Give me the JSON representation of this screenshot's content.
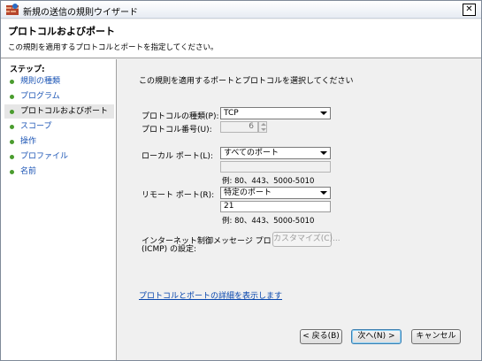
{
  "window": {
    "title": "新規の送信の規則ウイザード",
    "close_glyph": "✕"
  },
  "header": {
    "title": "プロトコルおよびポート",
    "description": "この規則を適用するプロトコルとポートを指定してください。"
  },
  "sidebar": {
    "steps_label": "ステップ:",
    "items": [
      {
        "label": "規則の種類",
        "current": false
      },
      {
        "label": "プログラム",
        "current": false
      },
      {
        "label": "プロトコルおよびポート",
        "current": true
      },
      {
        "label": "スコープ",
        "current": false
      },
      {
        "label": "操作",
        "current": false
      },
      {
        "label": "プロファイル",
        "current": false
      },
      {
        "label": "名前",
        "current": false
      }
    ]
  },
  "main": {
    "instruction": "この規則を適用するポートとプロトコルを選択してください",
    "protocol_type": {
      "label": "プロトコルの種類(P):",
      "value": "TCP"
    },
    "protocol_number": {
      "label": "プロトコル番号(U):",
      "value": "6"
    },
    "local_port": {
      "label": "ローカル ポート(L):",
      "value": "すべてのポート",
      "input_value": "",
      "example": "例: 80、443、5000-5010"
    },
    "remote_port": {
      "label": "リモート ポート(R):",
      "value": "特定のポート",
      "input_value": "21",
      "example": "例: 80、443、5000-5010"
    },
    "icmp": {
      "label_line1": "インターネット制御メッセージ プロトコル",
      "label_line2": "(ICMP) の設定:",
      "button": "カスタマイズ(C)..."
    },
    "details_link": "プロトコルとポートの詳細を表示します"
  },
  "footer": {
    "back": "< 戻る(B)",
    "next": "次へ(N) >",
    "cancel": "キャンセル"
  },
  "colors": {
    "step_dot": "#4a9c2e",
    "link": "#0645ad",
    "step_link": "#1c55b5"
  }
}
